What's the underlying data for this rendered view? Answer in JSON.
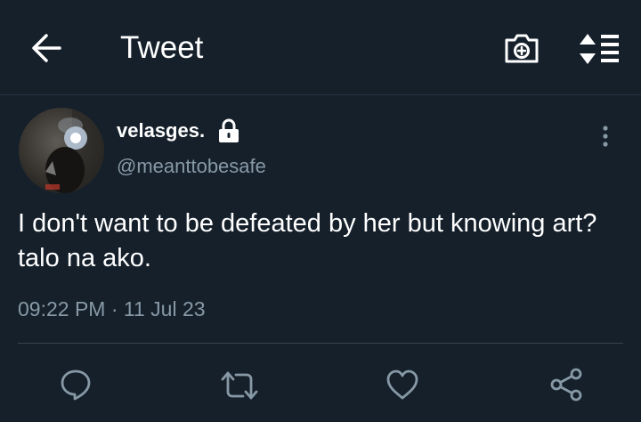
{
  "header": {
    "title": "Tweet",
    "back_icon": "arrow-left-icon",
    "camera_icon": "camera-plus-icon",
    "sort_icon": "sort-list-icon"
  },
  "tweet": {
    "display_name": "velasges.",
    "handle": "@meanttobesafe",
    "protected_icon": "lock-icon",
    "text": "I don't want to be defeated by her but knowing art? talo na ako.",
    "timestamp": "09:22 PM · 11 Jul 23",
    "more_icon": "more-vertical-icon"
  },
  "actions": [
    {
      "name": "reply",
      "icon": "reply-icon"
    },
    {
      "name": "retweet",
      "icon": "retweet-icon"
    },
    {
      "name": "like",
      "icon": "heart-icon"
    },
    {
      "name": "share",
      "icon": "share-icon"
    }
  ],
  "colors": {
    "background": "#15202b",
    "secondary_text": "#8899a6",
    "divider": "#38444d"
  }
}
